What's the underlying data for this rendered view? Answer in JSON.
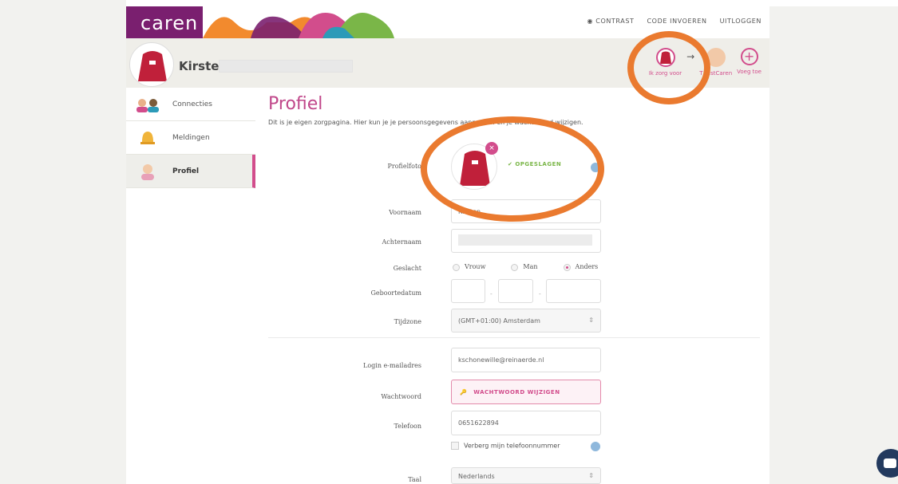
{
  "app": {
    "logo": "caren",
    "nav": {
      "contrast": "CONTRAST",
      "code": "CODE INVOEREN",
      "logout": "UITLOGGEN"
    }
  },
  "profile_header": {
    "name": "Kirsten"
  },
  "client_switch": {
    "self_label": "Ik zorg voor",
    "other_label": "T TestCaren",
    "add_label": "Voeg toe"
  },
  "sidebar": {
    "items": [
      {
        "label": "Connecties",
        "icon": "people-icon"
      },
      {
        "label": "Meldingen",
        "icon": "bell-icon"
      },
      {
        "label": "Profiel",
        "icon": "person-icon"
      }
    ]
  },
  "main": {
    "title": "Profiel",
    "subtitle": "Dit is je eigen zorgpagina. Hier kun je je persoonsgegevens aanpassen en je wachtwoord wijzigen.",
    "photo_label": "Profielfoto",
    "saved": "OPGESLAGEN",
    "fields": {
      "firstname_label": "Voornaam",
      "firstname_value": "Kirsten",
      "lastname_label": "Achternaam",
      "gender_label": "Geslacht",
      "gender_options": [
        "Vrouw",
        "Man",
        "Anders"
      ],
      "gender_selected": "Anders",
      "birthdate_label": "Geboortedatum",
      "timezone_label": "Tijdzone",
      "timezone_value": "(GMT+01:00) Amsterdam",
      "email_label": "Login e-mailadres",
      "email_value": "kschonewille@reinaerde.nl",
      "password_label": "Wachtwoord",
      "password_button": "WACHTWOORD WIJZIGEN",
      "phone_label": "Telefoon",
      "phone_value": "0651622894",
      "hide_phone": "Verberg mijn telefoonnummer",
      "language_label": "Taal",
      "language_value": "Nederlands"
    }
  },
  "colors": {
    "brand": "#d24d8c",
    "annotation": "#ea7a2f",
    "accent_green": "#7ab648"
  }
}
